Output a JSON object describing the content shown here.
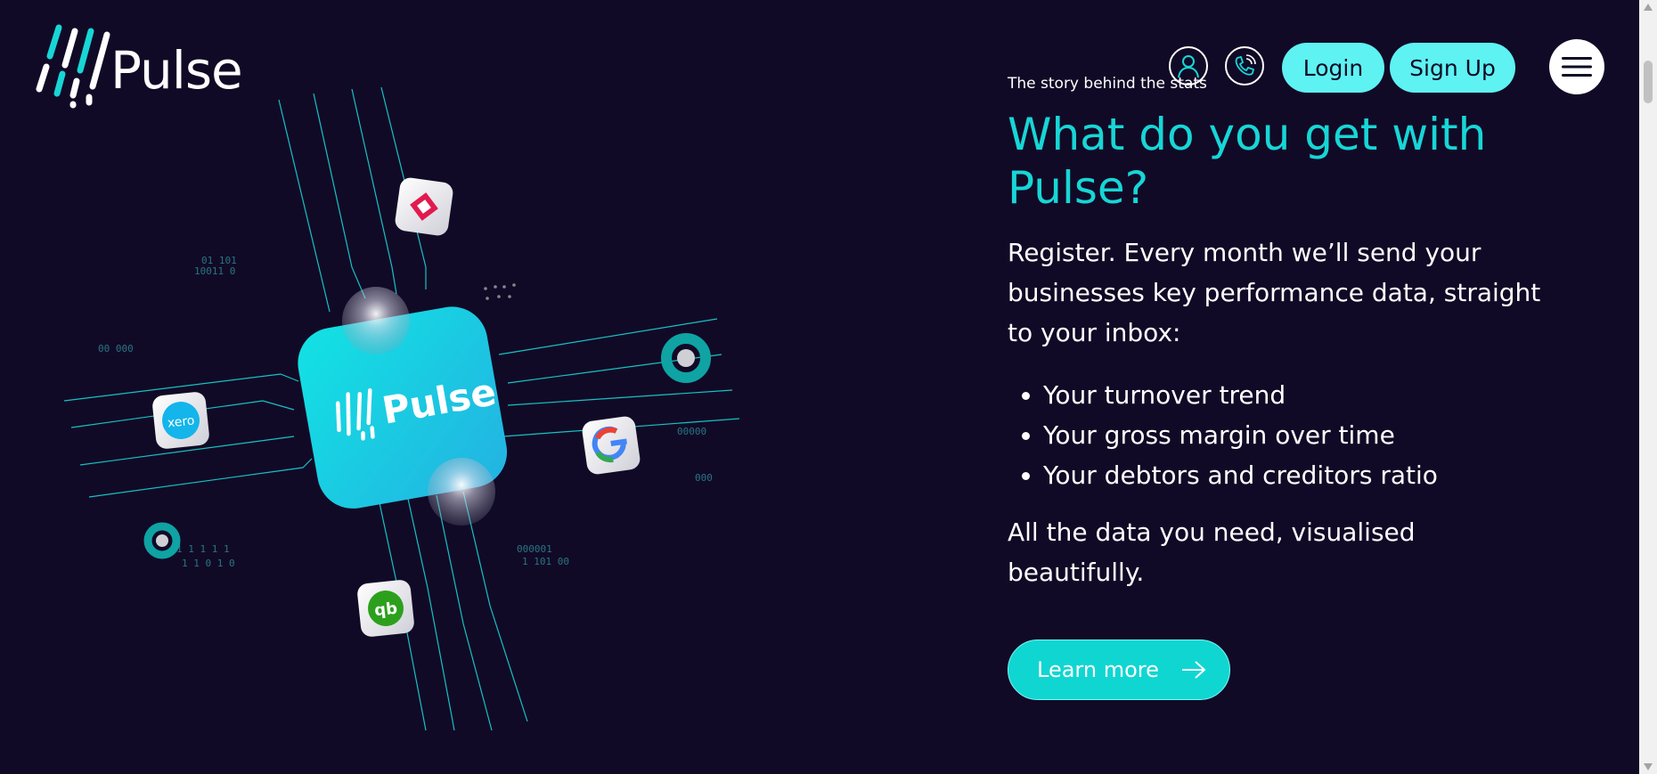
{
  "brand": {
    "name": "Pulse"
  },
  "header": {
    "account_icon": "user-icon",
    "phone_icon": "phone-icon",
    "login_label": "Login",
    "signup_label": "Sign Up",
    "menu_icon": "hamburger-menu-icon"
  },
  "hero": {
    "chip_label": "Pulse",
    "integrations": [
      "natwest-logo",
      "xero-logo",
      "google-logo",
      "quickbooks-logo"
    ]
  },
  "section": {
    "eyebrow": "The story behind the stats",
    "heading": "What do you get with Pulse?",
    "lead": "Register. Every month we’ll send your businesses key performance data, straight to your inbox:",
    "bullets": [
      "Your turnover trend",
      "Your gross margin over time",
      "Your debtors and creditors ratio"
    ],
    "closing": "All the data you need, visualised beautifully.",
    "cta_label": "Learn more"
  },
  "colors": {
    "background": "#110a26",
    "accent": "#17d6d6",
    "button": "#5ef2f2"
  }
}
